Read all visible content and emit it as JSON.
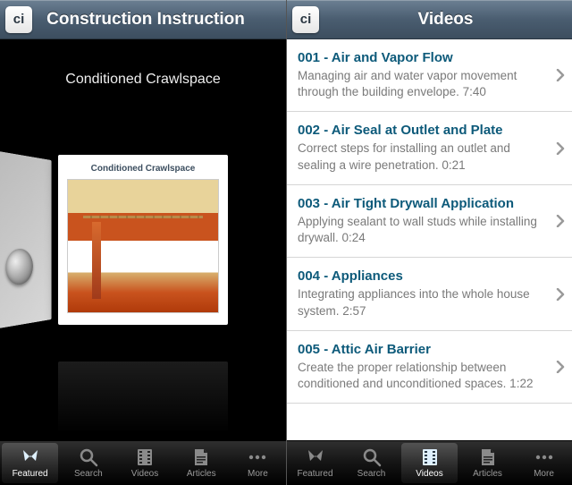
{
  "left": {
    "logo_text": "ci",
    "navbar_title": "Construction Instruction",
    "featured_title": "Conditioned Crawlspace",
    "card_caption": "Conditioned Crawlspace",
    "tabs": [
      {
        "label": "Featured",
        "icon": "featured-icon"
      },
      {
        "label": "Search",
        "icon": "search-icon"
      },
      {
        "label": "Videos",
        "icon": "videos-icon"
      },
      {
        "label": "Articles",
        "icon": "articles-icon"
      },
      {
        "label": "More",
        "icon": "more-icon"
      }
    ],
    "active_tab": 0
  },
  "right": {
    "logo_text": "ci",
    "navbar_title": "Videos",
    "items": [
      {
        "title": "001 - Air and Vapor Flow",
        "desc": "Managing air and water vapor movement through the building envelope. 7:40"
      },
      {
        "title": "002 - Air Seal at Outlet and Plate",
        "desc": "Correct steps for installing an outlet and sealing a wire penetration.   0:21"
      },
      {
        "title": "003 - Air Tight Drywall Application",
        "desc": "Applying sealant to wall studs while installing drywall.  0:24"
      },
      {
        "title": "004 - Appliances",
        "desc": "Integrating appliances into the whole house system.  2:57"
      },
      {
        "title": "005 - Attic Air Barrier",
        "desc": "Create the proper relationship between conditioned and unconditioned spaces.  1:22"
      }
    ],
    "tabs": [
      {
        "label": "Featured",
        "icon": "featured-icon"
      },
      {
        "label": "Search",
        "icon": "search-icon"
      },
      {
        "label": "Videos",
        "icon": "videos-icon"
      },
      {
        "label": "Articles",
        "icon": "articles-icon"
      },
      {
        "label": "More",
        "icon": "more-icon"
      }
    ],
    "active_tab": 2
  }
}
